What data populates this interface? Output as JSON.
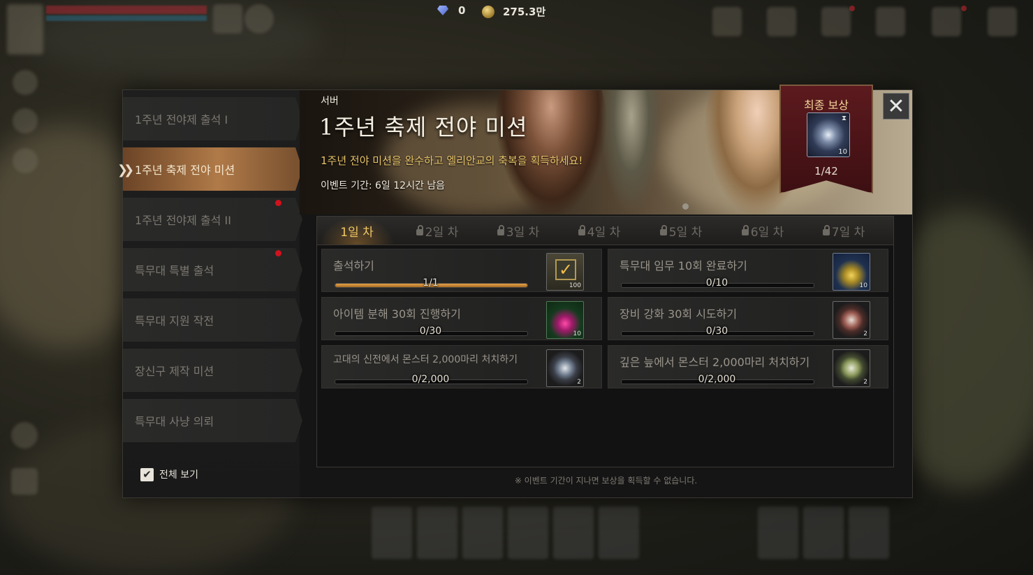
{
  "hud": {
    "gem_icon": "diamond-icon",
    "gem_count": "0",
    "coin_icon": "gold-coin-icon",
    "gold_amount": "275.3만"
  },
  "sidebar": {
    "items": [
      {
        "label": "1주년 전야제 출석 I",
        "active": false,
        "notify": false
      },
      {
        "label": "1주년 축제 전야 미션",
        "active": true,
        "notify": false
      },
      {
        "label": "1주년 전야제 출석 II",
        "active": false,
        "notify": true
      },
      {
        "label": "특무대 특별 출석",
        "active": false,
        "notify": true
      },
      {
        "label": "특무대 지원 작전",
        "active": false,
        "notify": false
      },
      {
        "label": "장신구 제작 미션",
        "active": false,
        "notify": false
      },
      {
        "label": "특무대 사냥 의뢰",
        "active": false,
        "notify": false
      }
    ],
    "show_all_label": "전체 보기",
    "show_all_checked": true
  },
  "banner": {
    "server": "서버",
    "title": "1주년 축제 전야 미션",
    "description": "1주년 전야 미션을 완수하고 엘리안교의 축복을 획득하세요!",
    "period": "이벤트 기간: 6일 12시간 남음"
  },
  "final_reward": {
    "title": "최종 보상",
    "item_icon": "blessing-hands-icon",
    "item_count": "10",
    "progress": "1/42"
  },
  "tabs": [
    {
      "label": "1일 차",
      "locked": false,
      "active": true
    },
    {
      "label": "2일 차",
      "locked": true,
      "active": false
    },
    {
      "label": "3일 차",
      "locked": true,
      "active": false
    },
    {
      "label": "4일 차",
      "locked": true,
      "active": false
    },
    {
      "label": "5일 차",
      "locked": true,
      "active": false
    },
    {
      "label": "6일 차",
      "locked": true,
      "active": false
    },
    {
      "label": "7일 차",
      "locked": true,
      "active": false
    }
  ],
  "missions": [
    {
      "label": "출석하기",
      "progress_text": "1/1",
      "progress": 1.0,
      "reward_count": "100",
      "reward_icon": "completed-check-icon"
    },
    {
      "label": "특무대 임무 10회 완료하기",
      "progress_text": "0/10",
      "progress": 0.0,
      "reward_count": "10",
      "reward_icon": "yellow-potion-icon"
    },
    {
      "label": "아이템 분해 30회 진행하기",
      "progress_text": "0/30",
      "progress": 0.0,
      "reward_count": "10",
      "reward_icon": "pink-potion-icon"
    },
    {
      "label": "장비 강화 30회 시도하기",
      "progress_text": "0/30",
      "progress": 0.0,
      "reward_count": "2",
      "reward_icon": "red-rune-icon"
    },
    {
      "label": "고대의 신전에서 몬스터 2,000마리 처치하기",
      "progress_text": "0/2,000",
      "progress": 0.0,
      "reward_count": "2",
      "reward_icon": "blue-rune-icon"
    },
    {
      "label": "깊은 늪에서 몬스터 2,000마리 처치하기",
      "progress_text": "0/2,000",
      "progress": 0.0,
      "reward_count": "2",
      "reward_icon": "green-rune-icon"
    }
  ],
  "footer_note": "※ 이벤트 기간이 지나면 보상을 획득할 수 없습니다.",
  "colors": {
    "accent_gold": "#f0c766",
    "active_tab_bg": "#b07a48",
    "notify_red": "#d0121c",
    "progress_fill": "#e7a34a"
  }
}
